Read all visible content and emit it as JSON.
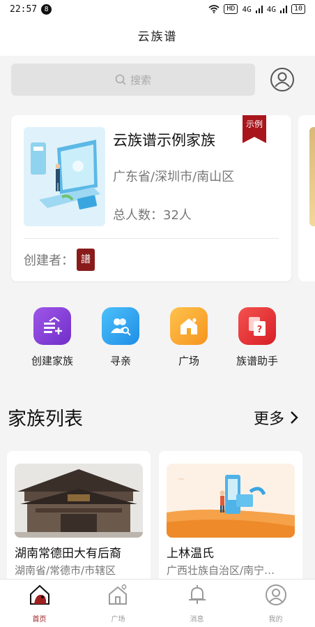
{
  "status_bar": {
    "time": "22:57",
    "notification_count": "8",
    "network_hd": "HD",
    "signal_1": "4G",
    "signal_2": "4G",
    "battery": "10"
  },
  "header": {
    "title": "云族谱"
  },
  "search": {
    "placeholder": "搜索"
  },
  "featured_family": {
    "name": "云族谱示例家族",
    "location": "广东省/深圳市/南山区",
    "member_count": "总人数：32人",
    "ribbon": "示例",
    "creator_label": "创建者：",
    "creator_seal": "譜"
  },
  "quick_actions": [
    {
      "label": "创建家族",
      "icon": "create-family-icon",
      "color": "#8c3fd8"
    },
    {
      "label": "寻亲",
      "icon": "find-relatives-icon",
      "color": "#2fa4f0"
    },
    {
      "label": "广场",
      "icon": "plaza-icon",
      "color": "#f5a623"
    },
    {
      "label": "族谱助手",
      "icon": "genealogy-assistant-icon",
      "color": "#e53935"
    }
  ],
  "family_list": {
    "title": "家族列表",
    "more_label": "更多",
    "items": [
      {
        "name": "湖南常德田大有后裔",
        "location": "湖南省/常德市/市辖区"
      },
      {
        "name": "上林温氏",
        "location": "广西壮族自治区/南宁…"
      }
    ]
  },
  "tabs": [
    {
      "label": "首页",
      "icon": "home-icon",
      "active": true
    },
    {
      "label": "广场",
      "icon": "plaza-icon",
      "active": false
    },
    {
      "label": "消息",
      "icon": "bell-icon",
      "active": false
    },
    {
      "label": "我的",
      "icon": "profile-icon",
      "active": false
    }
  ],
  "colors": {
    "accent": "#a02020",
    "ribbon": "#a8161c",
    "inactive_tab": "#9a9a9a"
  }
}
